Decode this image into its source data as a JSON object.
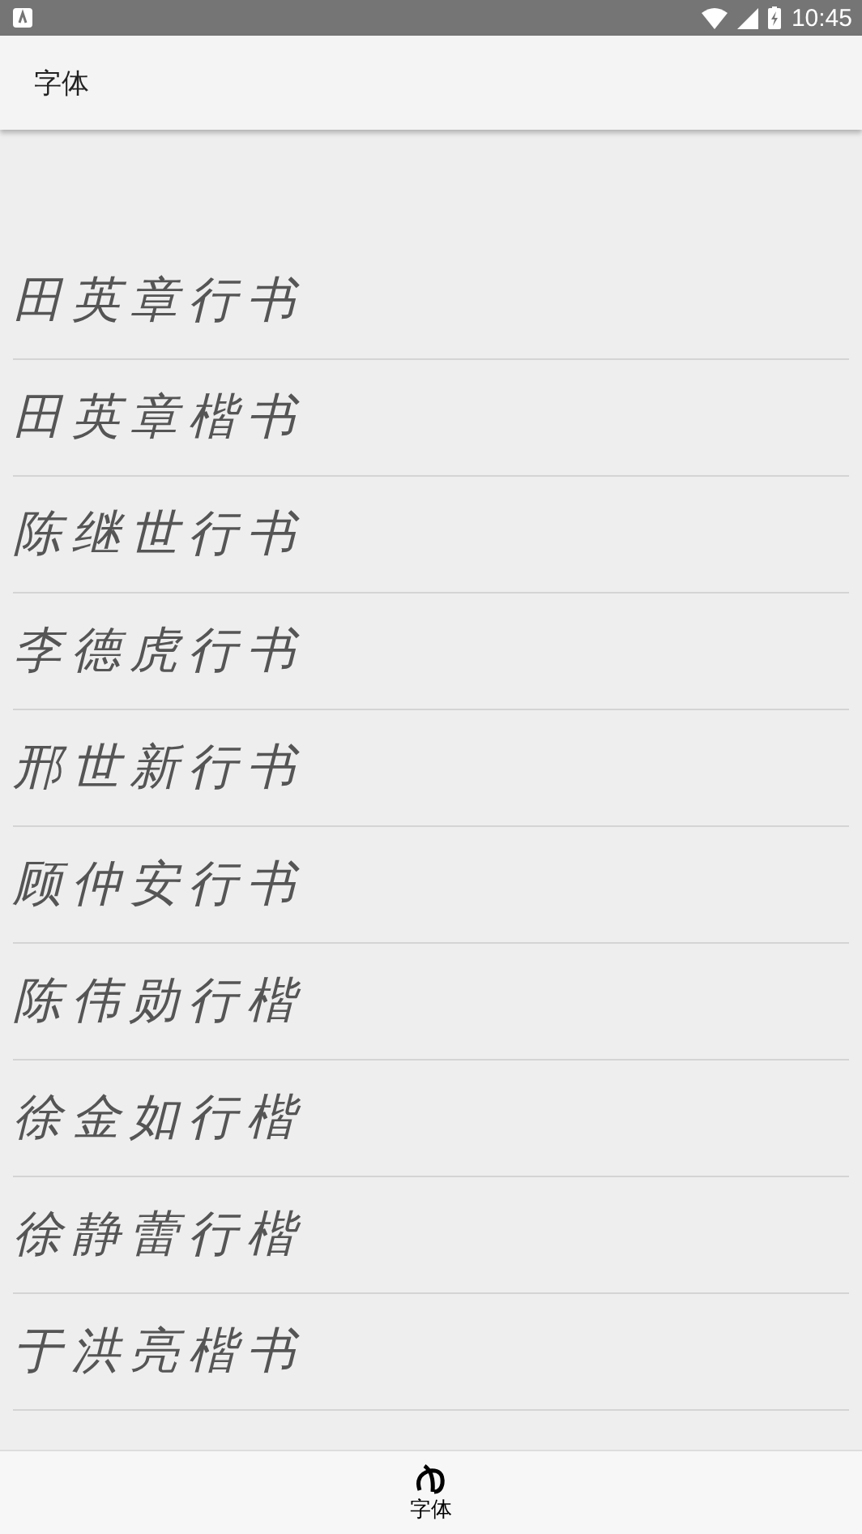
{
  "status_bar": {
    "time": "10:45"
  },
  "app_bar": {
    "title": "字体"
  },
  "fonts": [
    {
      "name": "田英章行书"
    },
    {
      "name": "田英章楷书"
    },
    {
      "name": "陈继世行书"
    },
    {
      "name": "李德虎行书"
    },
    {
      "name": "邢世新行书"
    },
    {
      "name": "顾仲安行书"
    },
    {
      "name": "陈伟勋行楷"
    },
    {
      "name": "徐金如行楷"
    },
    {
      "name": "徐静蕾行楷"
    },
    {
      "name": "于洪亮楷书"
    }
  ],
  "bottom_nav": [
    {
      "label": "字体",
      "selected": true
    }
  ]
}
